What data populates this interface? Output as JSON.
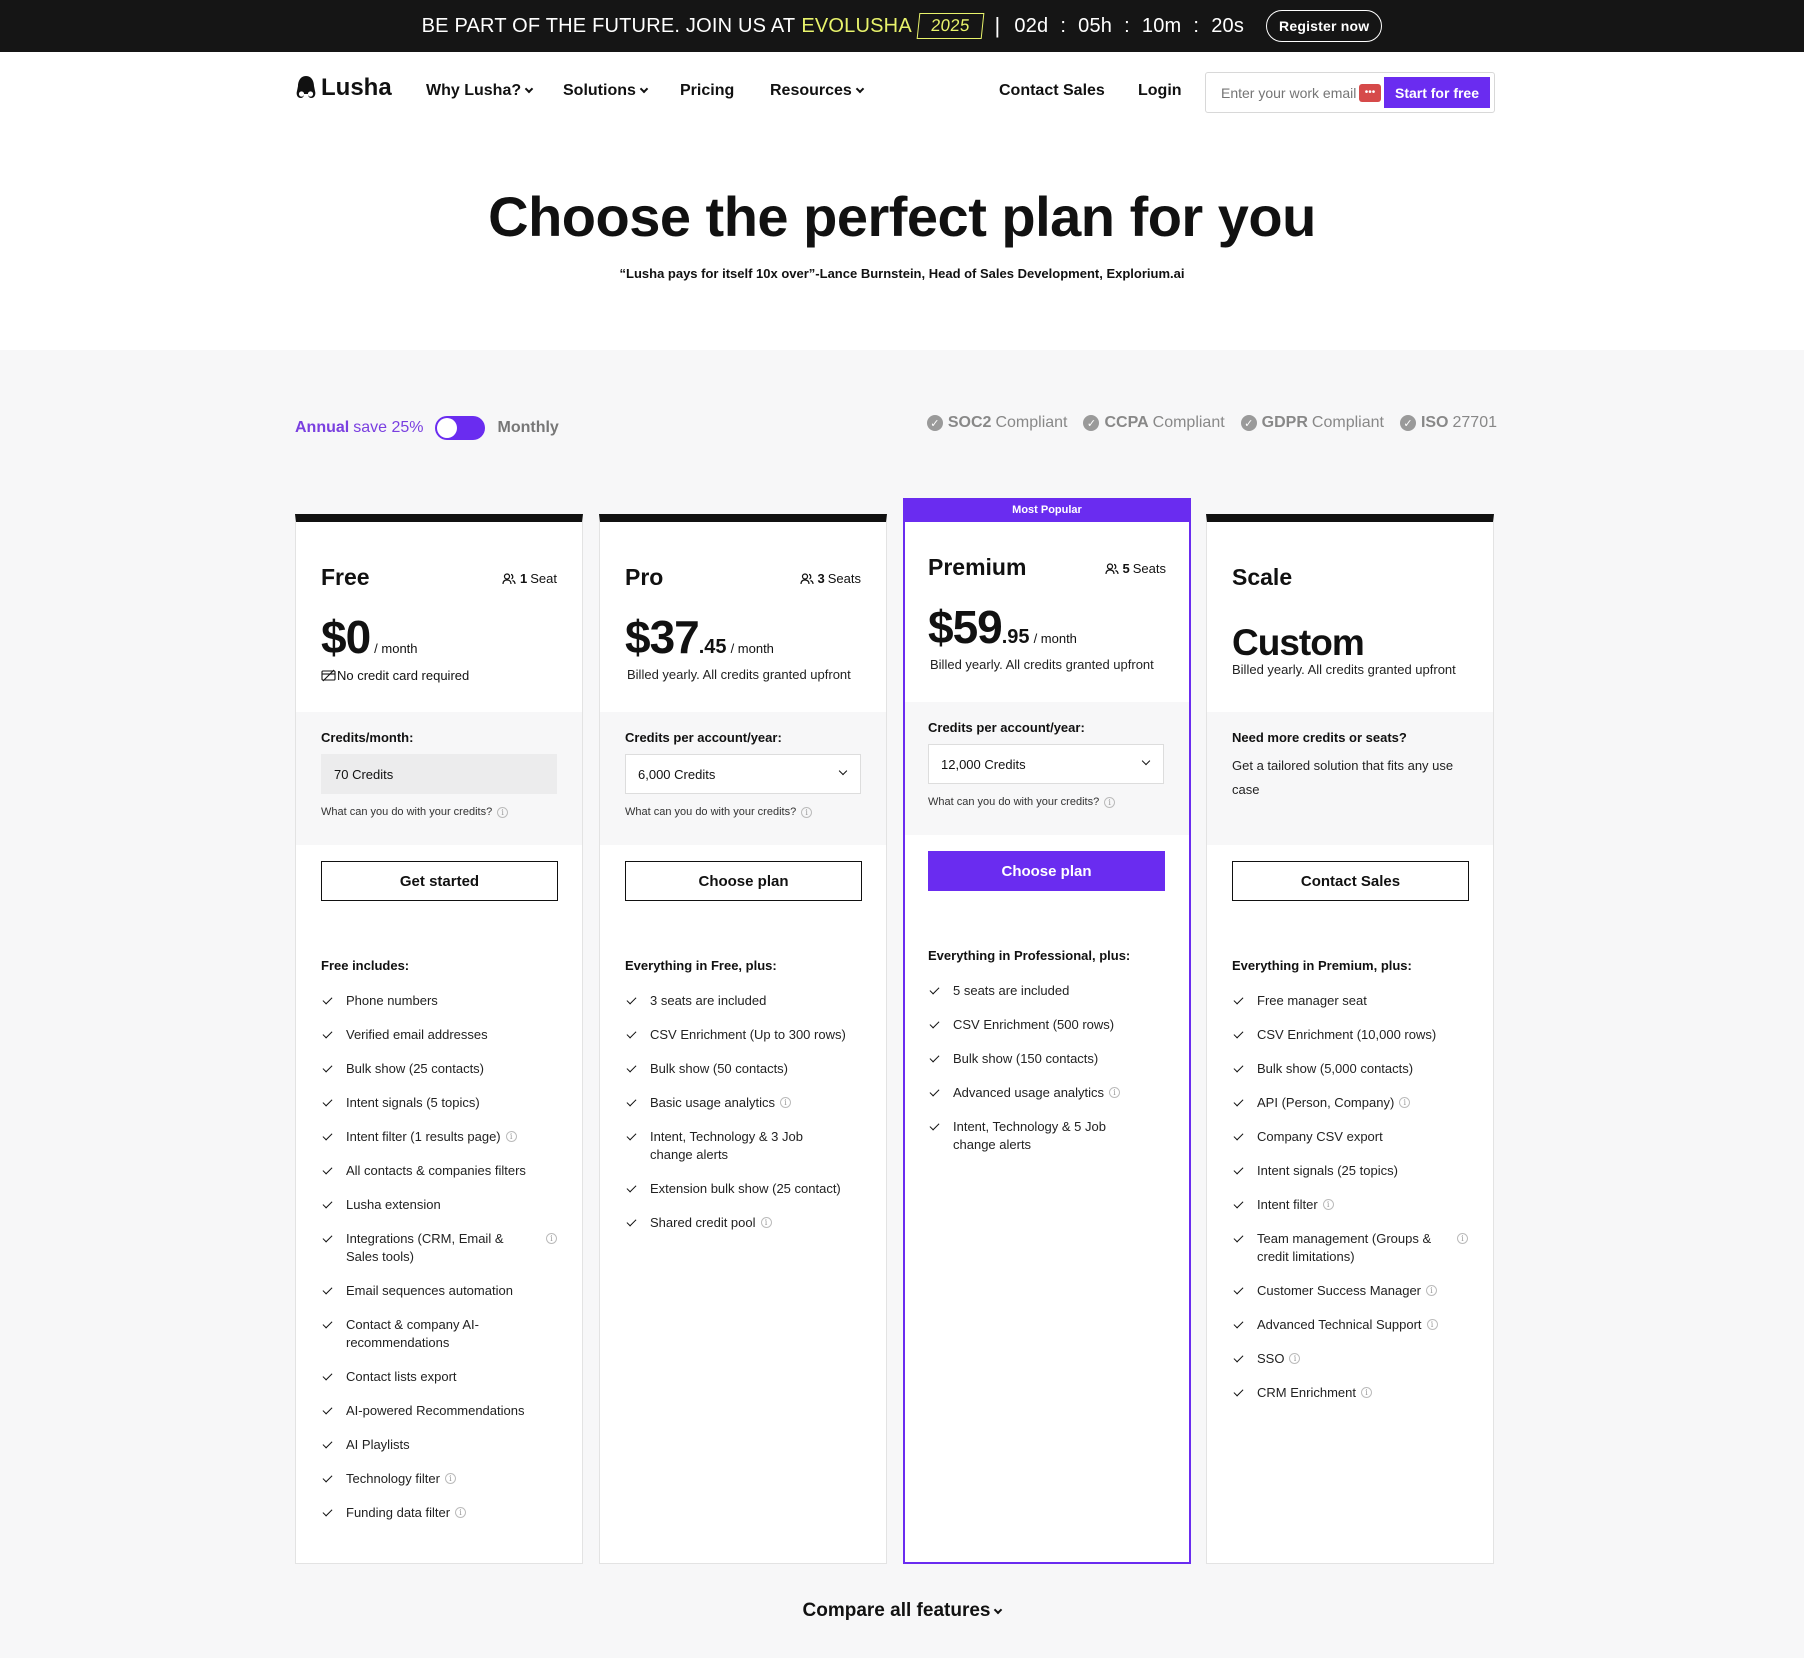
{
  "banner": {
    "text": "BE PART OF THE FUTURE. JOIN US AT",
    "brand": "EVOLUSHA",
    "year": "2025",
    "sep": "|",
    "days": "02d",
    "hours": "05h",
    "minutes": "10m",
    "seconds": "20s",
    "colon": ":",
    "register": "Register now"
  },
  "nav": {
    "logo": "Lusha",
    "links": [
      "Why Lusha?",
      "Solutions",
      "Pricing",
      "Resources"
    ],
    "contact_sales": "Contact Sales",
    "login": "Login",
    "email_placeholder": "Enter your work email",
    "email_badge": "•••",
    "start_free": "Start for free"
  },
  "hero": {
    "title": "Choose the perfect plan for you",
    "quote": "“Lusha pays for itself 10x over”-Lance Burnstein, Head of Sales Development, Explorium.ai"
  },
  "billing": {
    "annual": "Annual",
    "save": "save 25%",
    "monthly": "Monthly"
  },
  "compliance": [
    {
      "name": "SOC2",
      "label": "Compliant"
    },
    {
      "name": "CCPA",
      "label": "Compliant"
    },
    {
      "name": "GDPR",
      "label": "Compliant"
    },
    {
      "name": "ISO",
      "label": "27701"
    }
  ],
  "colors": {
    "accent": "#6a2cf0",
    "banner_bg": "#151515",
    "banner_highlight": "#e8f36b"
  },
  "plans": {
    "free": {
      "name": "Free",
      "seats_num": "1",
      "seats_label": "Seat",
      "price": "$0",
      "per": "/ month",
      "note": "No credit card required",
      "credits_label": "Credits/month:",
      "credits_num": "70",
      "credits_unit": "Credits",
      "credits_help": "What can you do with your credits?",
      "cta": "Get started",
      "includes_title": "Free includes:",
      "features": [
        "Phone numbers",
        "Verified email addresses",
        "Bulk show (25 contacts)",
        "Intent signals (5 topics)",
        "Intent filter (1 results page)",
        "All contacts & companies filters",
        "Lusha extension",
        "Integrations (CRM, Email & Sales tools)",
        "Email sequences automation",
        "Contact & company AI-recommendations",
        "Contact lists export",
        "AI-powered Recommendations",
        "AI Playlists",
        "Technology filter",
        "Funding data filter"
      ]
    },
    "pro": {
      "name": "Pro",
      "seats_num": "3",
      "seats_label": "Seats",
      "price": "$37",
      "cents": ".45",
      "per": "/ month",
      "billed": "Billed yearly. All credits granted upfront",
      "credits_label": "Credits per account/year:",
      "credits_num": "6,000",
      "credits_unit": "Credits",
      "credits_help": "What can you do with your credits?",
      "cta": "Choose plan",
      "includes_title": "Everything in Free, plus:",
      "features": [
        "3 seats are included",
        "CSV Enrichment (Up to 300 rows)",
        "Bulk show (50 contacts)",
        "Basic usage analytics",
        "Intent, Technology & 3 Job change alerts",
        "Extension bulk show (25 contact)",
        "Shared credit pool"
      ]
    },
    "premium": {
      "badge": "Most Popular",
      "name": "Premium",
      "seats_num": "5",
      "seats_label": "Seats",
      "price": "$59",
      "cents": ".95",
      "per": "/ month",
      "billed": "Billed yearly. All credits granted upfront",
      "credits_label": "Credits per account/year:",
      "credits_num": "12,000",
      "credits_unit": "Credits",
      "credits_help": "What can you do with your credits?",
      "cta": "Choose plan",
      "includes_title": "Everything in Professional, plus:",
      "features": [
        "5 seats are included",
        "CSV Enrichment (500 rows)",
        "Bulk show (150 contacts)",
        "Advanced usage analytics",
        "Intent, Technology & 5 Job change alerts"
      ]
    },
    "scale": {
      "name": "Scale",
      "price": "Custom",
      "billed": "Billed yearly. All credits granted upfront",
      "more_label": "Need more credits or seats?",
      "tailored": "Get a tailored solution that fits any use case",
      "cta": "Contact Sales",
      "includes_title": "Everything in Premium, plus:",
      "features": [
        "Free manager seat",
        "CSV Enrichment (10,000 rows)",
        "Bulk show (5,000 contacts)",
        "API (Person, Company)",
        "Company CSV export",
        "Intent signals (25 topics)",
        "Intent filter",
        "Team management (Groups & credit limitations)",
        "Customer Success Manager",
        "Advanced Technical Support",
        "SSO",
        "CRM Enrichment"
      ]
    }
  },
  "compare": "Compare all features"
}
